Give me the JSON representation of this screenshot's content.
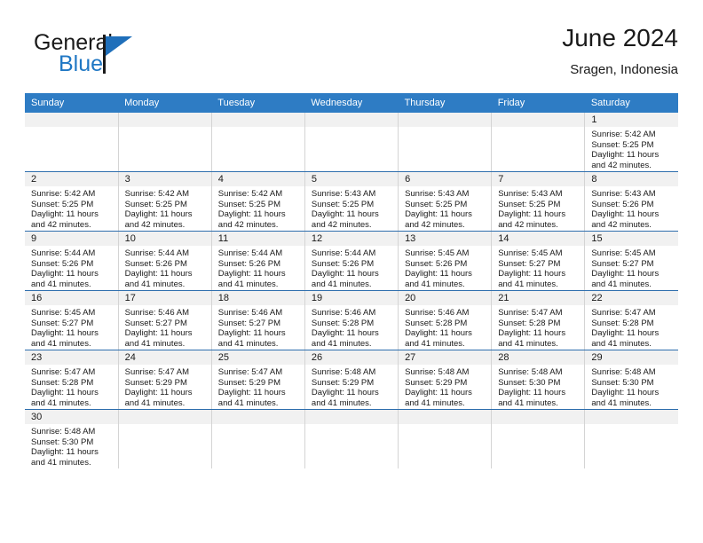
{
  "brand": {
    "word_one": "General",
    "word_two": "Blue",
    "accent_color": "#1f77c4"
  },
  "header": {
    "title": "June 2024",
    "subtitle": "Sragen, Indonesia"
  },
  "theme": {
    "header_row_bg": "#2e7cc4",
    "daynum_band_bg": "#f1f1f1",
    "row_border": "#2e6ead",
    "cell_border": "#d4d4d4"
  },
  "weekday_headers": [
    "Sunday",
    "Monday",
    "Tuesday",
    "Wednesday",
    "Thursday",
    "Friday",
    "Saturday"
  ],
  "weeks": [
    [
      {
        "day": "",
        "sunrise": "",
        "sunset": "",
        "daylight_line1": "",
        "daylight_line2": "",
        "empty": true
      },
      {
        "day": "",
        "sunrise": "",
        "sunset": "",
        "daylight_line1": "",
        "daylight_line2": "",
        "empty": true
      },
      {
        "day": "",
        "sunrise": "",
        "sunset": "",
        "daylight_line1": "",
        "daylight_line2": "",
        "empty": true
      },
      {
        "day": "",
        "sunrise": "",
        "sunset": "",
        "daylight_line1": "",
        "daylight_line2": "",
        "empty": true
      },
      {
        "day": "",
        "sunrise": "",
        "sunset": "",
        "daylight_line1": "",
        "daylight_line2": "",
        "empty": true
      },
      {
        "day": "",
        "sunrise": "",
        "sunset": "",
        "daylight_line1": "",
        "daylight_line2": "",
        "empty": true
      },
      {
        "day": "1",
        "sunrise": "Sunrise: 5:42 AM",
        "sunset": "Sunset: 5:25 PM",
        "daylight_line1": "Daylight: 11 hours",
        "daylight_line2": "and 42 minutes.",
        "empty": false
      }
    ],
    [
      {
        "day": "2",
        "sunrise": "Sunrise: 5:42 AM",
        "sunset": "Sunset: 5:25 PM",
        "daylight_line1": "Daylight: 11 hours",
        "daylight_line2": "and 42 minutes.",
        "empty": false
      },
      {
        "day": "3",
        "sunrise": "Sunrise: 5:42 AM",
        "sunset": "Sunset: 5:25 PM",
        "daylight_line1": "Daylight: 11 hours",
        "daylight_line2": "and 42 minutes.",
        "empty": false
      },
      {
        "day": "4",
        "sunrise": "Sunrise: 5:42 AM",
        "sunset": "Sunset: 5:25 PM",
        "daylight_line1": "Daylight: 11 hours",
        "daylight_line2": "and 42 minutes.",
        "empty": false
      },
      {
        "day": "5",
        "sunrise": "Sunrise: 5:43 AM",
        "sunset": "Sunset: 5:25 PM",
        "daylight_line1": "Daylight: 11 hours",
        "daylight_line2": "and 42 minutes.",
        "empty": false
      },
      {
        "day": "6",
        "sunrise": "Sunrise: 5:43 AM",
        "sunset": "Sunset: 5:25 PM",
        "daylight_line1": "Daylight: 11 hours",
        "daylight_line2": "and 42 minutes.",
        "empty": false
      },
      {
        "day": "7",
        "sunrise": "Sunrise: 5:43 AM",
        "sunset": "Sunset: 5:25 PM",
        "daylight_line1": "Daylight: 11 hours",
        "daylight_line2": "and 42 minutes.",
        "empty": false
      },
      {
        "day": "8",
        "sunrise": "Sunrise: 5:43 AM",
        "sunset": "Sunset: 5:26 PM",
        "daylight_line1": "Daylight: 11 hours",
        "daylight_line2": "and 42 minutes.",
        "empty": false
      }
    ],
    [
      {
        "day": "9",
        "sunrise": "Sunrise: 5:44 AM",
        "sunset": "Sunset: 5:26 PM",
        "daylight_line1": "Daylight: 11 hours",
        "daylight_line2": "and 41 minutes.",
        "empty": false
      },
      {
        "day": "10",
        "sunrise": "Sunrise: 5:44 AM",
        "sunset": "Sunset: 5:26 PM",
        "daylight_line1": "Daylight: 11 hours",
        "daylight_line2": "and 41 minutes.",
        "empty": false
      },
      {
        "day": "11",
        "sunrise": "Sunrise: 5:44 AM",
        "sunset": "Sunset: 5:26 PM",
        "daylight_line1": "Daylight: 11 hours",
        "daylight_line2": "and 41 minutes.",
        "empty": false
      },
      {
        "day": "12",
        "sunrise": "Sunrise: 5:44 AM",
        "sunset": "Sunset: 5:26 PM",
        "daylight_line1": "Daylight: 11 hours",
        "daylight_line2": "and 41 minutes.",
        "empty": false
      },
      {
        "day": "13",
        "sunrise": "Sunrise: 5:45 AM",
        "sunset": "Sunset: 5:26 PM",
        "daylight_line1": "Daylight: 11 hours",
        "daylight_line2": "and 41 minutes.",
        "empty": false
      },
      {
        "day": "14",
        "sunrise": "Sunrise: 5:45 AM",
        "sunset": "Sunset: 5:27 PM",
        "daylight_line1": "Daylight: 11 hours",
        "daylight_line2": "and 41 minutes.",
        "empty": false
      },
      {
        "day": "15",
        "sunrise": "Sunrise: 5:45 AM",
        "sunset": "Sunset: 5:27 PM",
        "daylight_line1": "Daylight: 11 hours",
        "daylight_line2": "and 41 minutes.",
        "empty": false
      }
    ],
    [
      {
        "day": "16",
        "sunrise": "Sunrise: 5:45 AM",
        "sunset": "Sunset: 5:27 PM",
        "daylight_line1": "Daylight: 11 hours",
        "daylight_line2": "and 41 minutes.",
        "empty": false
      },
      {
        "day": "17",
        "sunrise": "Sunrise: 5:46 AM",
        "sunset": "Sunset: 5:27 PM",
        "daylight_line1": "Daylight: 11 hours",
        "daylight_line2": "and 41 minutes.",
        "empty": false
      },
      {
        "day": "18",
        "sunrise": "Sunrise: 5:46 AM",
        "sunset": "Sunset: 5:27 PM",
        "daylight_line1": "Daylight: 11 hours",
        "daylight_line2": "and 41 minutes.",
        "empty": false
      },
      {
        "day": "19",
        "sunrise": "Sunrise: 5:46 AM",
        "sunset": "Sunset: 5:28 PM",
        "daylight_line1": "Daylight: 11 hours",
        "daylight_line2": "and 41 minutes.",
        "empty": false
      },
      {
        "day": "20",
        "sunrise": "Sunrise: 5:46 AM",
        "sunset": "Sunset: 5:28 PM",
        "daylight_line1": "Daylight: 11 hours",
        "daylight_line2": "and 41 minutes.",
        "empty": false
      },
      {
        "day": "21",
        "sunrise": "Sunrise: 5:47 AM",
        "sunset": "Sunset: 5:28 PM",
        "daylight_line1": "Daylight: 11 hours",
        "daylight_line2": "and 41 minutes.",
        "empty": false
      },
      {
        "day": "22",
        "sunrise": "Sunrise: 5:47 AM",
        "sunset": "Sunset: 5:28 PM",
        "daylight_line1": "Daylight: 11 hours",
        "daylight_line2": "and 41 minutes.",
        "empty": false
      }
    ],
    [
      {
        "day": "23",
        "sunrise": "Sunrise: 5:47 AM",
        "sunset": "Sunset: 5:28 PM",
        "daylight_line1": "Daylight: 11 hours",
        "daylight_line2": "and 41 minutes.",
        "empty": false
      },
      {
        "day": "24",
        "sunrise": "Sunrise: 5:47 AM",
        "sunset": "Sunset: 5:29 PM",
        "daylight_line1": "Daylight: 11 hours",
        "daylight_line2": "and 41 minutes.",
        "empty": false
      },
      {
        "day": "25",
        "sunrise": "Sunrise: 5:47 AM",
        "sunset": "Sunset: 5:29 PM",
        "daylight_line1": "Daylight: 11 hours",
        "daylight_line2": "and 41 minutes.",
        "empty": false
      },
      {
        "day": "26",
        "sunrise": "Sunrise: 5:48 AM",
        "sunset": "Sunset: 5:29 PM",
        "daylight_line1": "Daylight: 11 hours",
        "daylight_line2": "and 41 minutes.",
        "empty": false
      },
      {
        "day": "27",
        "sunrise": "Sunrise: 5:48 AM",
        "sunset": "Sunset: 5:29 PM",
        "daylight_line1": "Daylight: 11 hours",
        "daylight_line2": "and 41 minutes.",
        "empty": false
      },
      {
        "day": "28",
        "sunrise": "Sunrise: 5:48 AM",
        "sunset": "Sunset: 5:30 PM",
        "daylight_line1": "Daylight: 11 hours",
        "daylight_line2": "and 41 minutes.",
        "empty": false
      },
      {
        "day": "29",
        "sunrise": "Sunrise: 5:48 AM",
        "sunset": "Sunset: 5:30 PM",
        "daylight_line1": "Daylight: 11 hours",
        "daylight_line2": "and 41 minutes.",
        "empty": false
      }
    ],
    [
      {
        "day": "30",
        "sunrise": "Sunrise: 5:48 AM",
        "sunset": "Sunset: 5:30 PM",
        "daylight_line1": "Daylight: 11 hours",
        "daylight_line2": "and 41 minutes.",
        "empty": false
      },
      {
        "day": "",
        "sunrise": "",
        "sunset": "",
        "daylight_line1": "",
        "daylight_line2": "",
        "empty": true
      },
      {
        "day": "",
        "sunrise": "",
        "sunset": "",
        "daylight_line1": "",
        "daylight_line2": "",
        "empty": true
      },
      {
        "day": "",
        "sunrise": "",
        "sunset": "",
        "daylight_line1": "",
        "daylight_line2": "",
        "empty": true
      },
      {
        "day": "",
        "sunrise": "",
        "sunset": "",
        "daylight_line1": "",
        "daylight_line2": "",
        "empty": true
      },
      {
        "day": "",
        "sunrise": "",
        "sunset": "",
        "daylight_line1": "",
        "daylight_line2": "",
        "empty": true
      },
      {
        "day": "",
        "sunrise": "",
        "sunset": "",
        "daylight_line1": "",
        "daylight_line2": "",
        "empty": true
      }
    ]
  ]
}
